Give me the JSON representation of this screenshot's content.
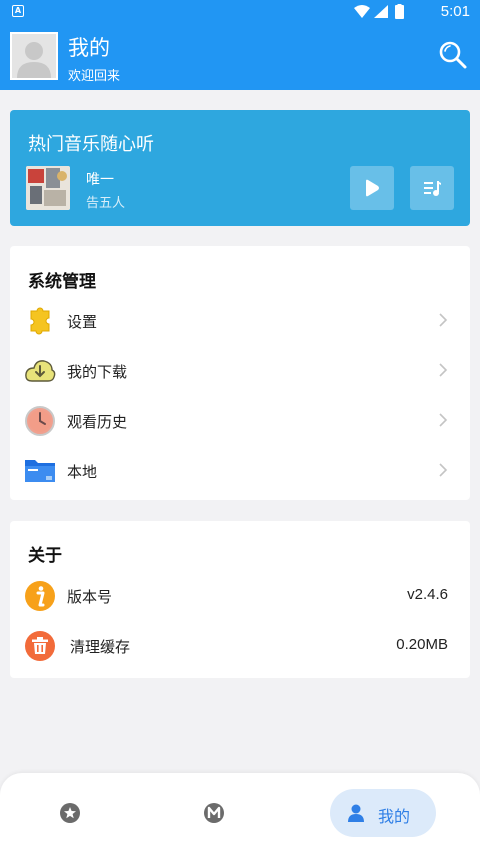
{
  "status_bar": {
    "time": "5:01",
    "left_icon": "A"
  },
  "header": {
    "title": "我的",
    "subtitle": "欢迎回来",
    "search_icon": "search-icon",
    "background_color": "#2196f3"
  },
  "music_card": {
    "title": "热门音乐随心听",
    "song": "唯一",
    "artist": "告五人",
    "background_color": "#2ea7df"
  },
  "system_section": {
    "title": "系统管理",
    "items": [
      {
        "label": "设置",
        "icon": "puzzle-gear-icon"
      },
      {
        "label": "我的下载",
        "icon": "cloud-download-icon"
      },
      {
        "label": "观看历史",
        "icon": "clock-icon"
      },
      {
        "label": "本地",
        "icon": "folder-icon"
      }
    ]
  },
  "about_section": {
    "title": "关于",
    "items": [
      {
        "label": "版本号",
        "value": "v2.4.6",
        "icon": "info-icon"
      },
      {
        "label": "清理缓存",
        "value": "0.20MB",
        "icon": "trash-icon"
      }
    ]
  },
  "bottom_nav": {
    "items": [
      {
        "icon": "star-badge-icon"
      },
      {
        "icon": "m-badge-icon"
      },
      {
        "label": "我的",
        "icon": "user-icon",
        "active": true
      }
    ],
    "active_color": "#2f7fe6"
  }
}
